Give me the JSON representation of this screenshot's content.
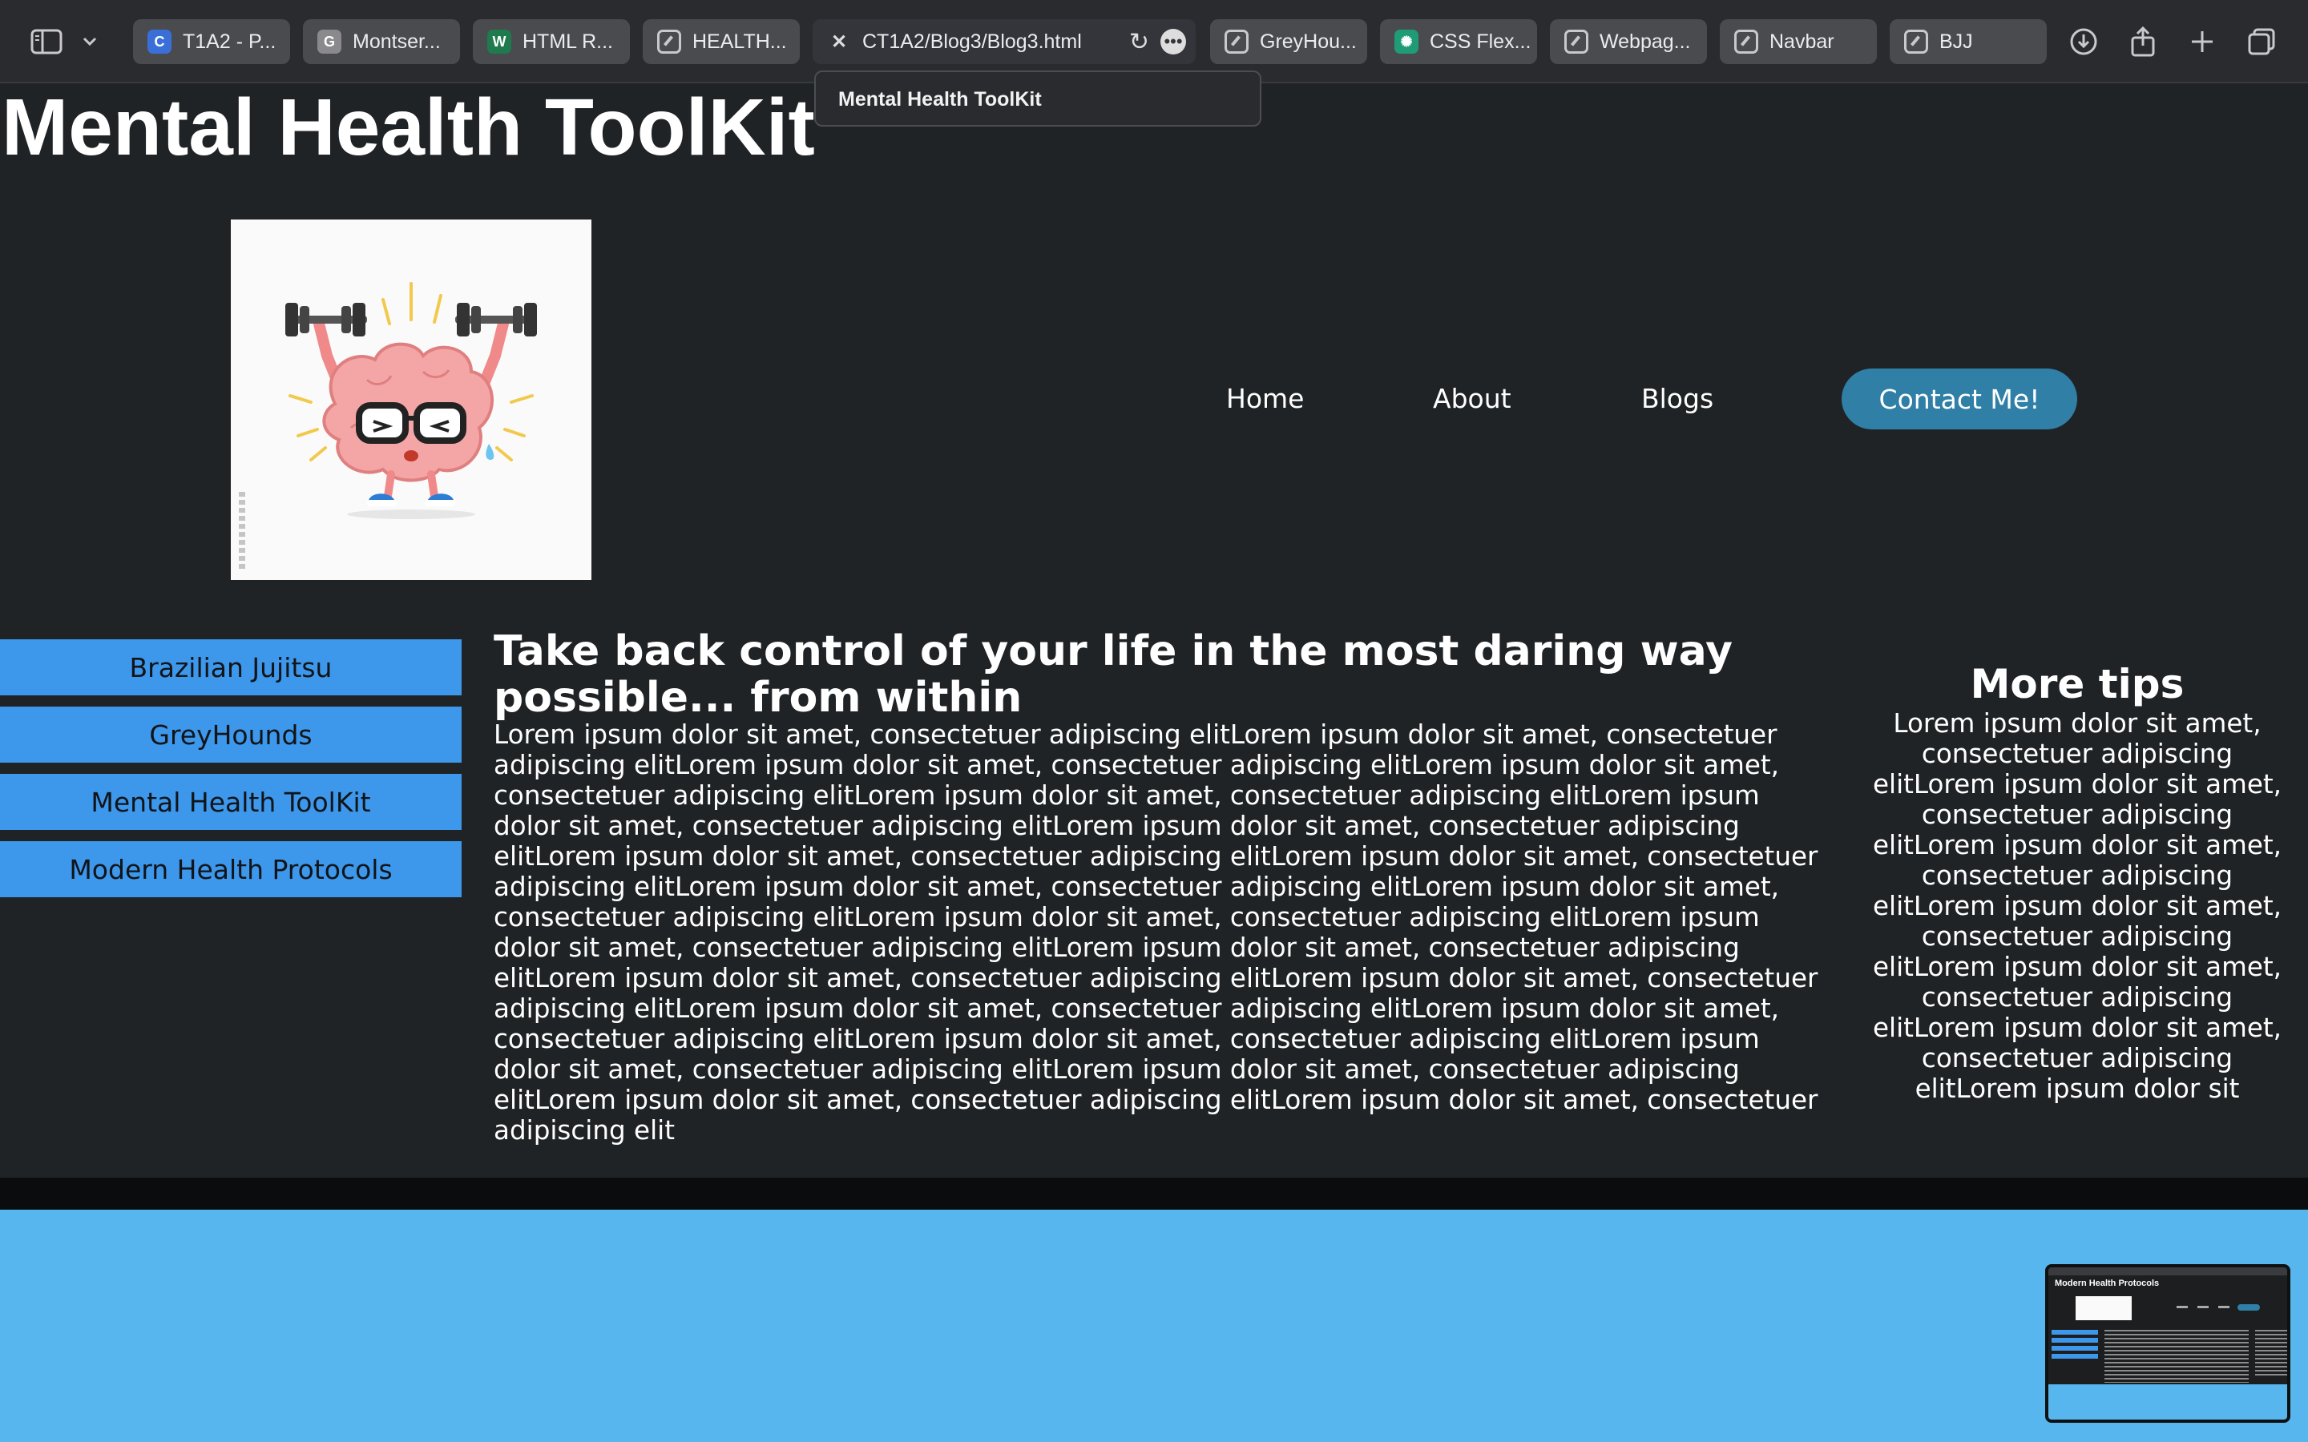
{
  "browser": {
    "tabs": [
      {
        "label": "T1A2 - P...",
        "favicon": "canva-icon",
        "color": "#3b6fd8",
        "glyph": "C"
      },
      {
        "label": "Montser...",
        "favicon": "google-g-icon",
        "color": "#8a8a8e",
        "glyph": "G"
      },
      {
        "label": "HTML R...",
        "favicon": "w3-icon",
        "color": "#1f7a4d",
        "glyph": "W"
      },
      {
        "label": "HEALTH...",
        "favicon": "compass-icon",
        "color": "",
        "glyph": ""
      },
      {
        "label": "GreyHou...",
        "favicon": "compass-icon",
        "color": "",
        "glyph": ""
      },
      {
        "label": "CSS Flex...",
        "favicon": "chatgpt-icon",
        "color": "#1f9b76",
        "glyph": "✺"
      },
      {
        "label": "Webpag...",
        "favicon": "compass-icon",
        "color": "",
        "glyph": ""
      },
      {
        "label": "Navbar",
        "favicon": "compass-icon",
        "color": "",
        "glyph": ""
      },
      {
        "label": "BJJ",
        "favicon": "compass-icon",
        "color": "",
        "glyph": ""
      }
    ],
    "active_tab": {
      "url": "CT1A2/Blog3/Blog3.html"
    },
    "tooltip": "Mental Health ToolKit"
  },
  "page": {
    "site_title": "Mental Health ToolKit",
    "hero_image": "brain-lifting-dumbbells-cartoon",
    "nav": {
      "home": "Home",
      "about": "About",
      "blogs": "Blogs",
      "contact": "Contact Me!"
    },
    "sidebar": [
      "Brazilian Jujitsu",
      "GreyHounds",
      "Mental Health ToolKit",
      "Modern Health Protocols"
    ],
    "article": {
      "heading": "Take back control of your life in the most daring way possible... from within",
      "body": "Lorem ipsum dolor sit amet, consectetuer adipiscing elitLorem ipsum dolor sit amet, consectetuer adipiscing elitLorem ipsum dolor sit amet, consectetuer adipiscing elitLorem ipsum dolor sit amet, consectetuer adipiscing elitLorem ipsum dolor sit amet, consectetuer adipiscing elitLorem ipsum dolor sit amet, consectetuer adipiscing elitLorem ipsum dolor sit amet, consectetuer adipiscing elitLorem ipsum dolor sit amet, consectetuer adipiscing elitLorem ipsum dolor sit amet, consectetuer adipiscing elitLorem ipsum dolor sit amet, consectetuer adipiscing elitLorem ipsum dolor sit amet, consectetuer adipiscing elitLorem ipsum dolor sit amet, consectetuer adipiscing elitLorem ipsum dolor sit amet, consectetuer adipiscing elitLorem ipsum dolor sit amet, consectetuer adipiscing elitLorem ipsum dolor sit amet, consectetuer adipiscing elitLorem ipsum dolor sit amet, consectetuer adipiscing elitLorem ipsum dolor sit amet, consectetuer adipiscing elitLorem ipsum dolor sit amet, consectetuer adipiscing elitLorem ipsum dolor sit amet, consectetuer adipiscing elitLorem ipsum dolor sit amet, consectetuer adipiscing elitLorem ipsum dolor sit amet, consectetuer adipiscing elitLorem ipsum dolor sit amet, consectetuer adipiscing elitLorem ipsum dolor sit amet, consectetuer adipiscing elit"
    },
    "aside": {
      "heading": "More tips",
      "body": "Lorem ipsum dolor sit amet, consectetuer adipiscing elitLorem ipsum dolor sit amet, consectetuer adipiscing elitLorem ipsum dolor sit amet, consectetuer adipiscing elitLorem ipsum dolor sit amet, consectetuer adipiscing elitLorem ipsum dolor sit amet, consectetuer adipiscing elitLorem ipsum dolor sit amet, consectetuer adipiscing elitLorem ipsum dolor sit"
    },
    "thumbnail_title": "Modern Health Protocols"
  },
  "colors": {
    "page_bg": "#202326",
    "sidebar_button": "#3d97ea",
    "contact_button": "#2f7fa6",
    "footer": "#58b6ee"
  }
}
